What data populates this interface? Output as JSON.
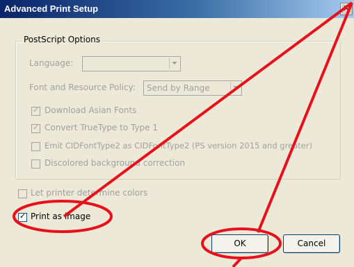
{
  "window": {
    "title": "Advanced Print Setup",
    "close_glyph": "✕"
  },
  "postscript": {
    "legend": "PostScript Options",
    "language_label": "Language:",
    "language_value": "",
    "font_policy_label": "Font and Resource Policy:",
    "font_policy_value": "Send by Range",
    "download_asian_fonts": {
      "label": "Download Asian Fonts",
      "checked": true,
      "enabled": false
    },
    "convert_truetype": {
      "label": "Convert TrueType to Type 1",
      "checked": true,
      "enabled": false
    },
    "emit_cidfont": {
      "label": "Emit CIDFontType2 as CIDFontType2 (PS version 2015 and greater)",
      "checked": false,
      "enabled": false
    },
    "discolored_bg": {
      "label": "Discolored background correction",
      "checked": false,
      "enabled": false
    }
  },
  "let_printer_colors": {
    "label": "Let printer determine colors",
    "checked": false,
    "enabled": false
  },
  "print_as_image": {
    "label": "Print as image",
    "checked": true,
    "enabled": true
  },
  "buttons": {
    "ok": "OK",
    "cancel": "Cancel"
  },
  "colors": {
    "annotation": "#e8101a",
    "title_bar": "#0a246a",
    "dialog_bg": "#ece9d8"
  },
  "icons": {
    "check": "✓"
  }
}
